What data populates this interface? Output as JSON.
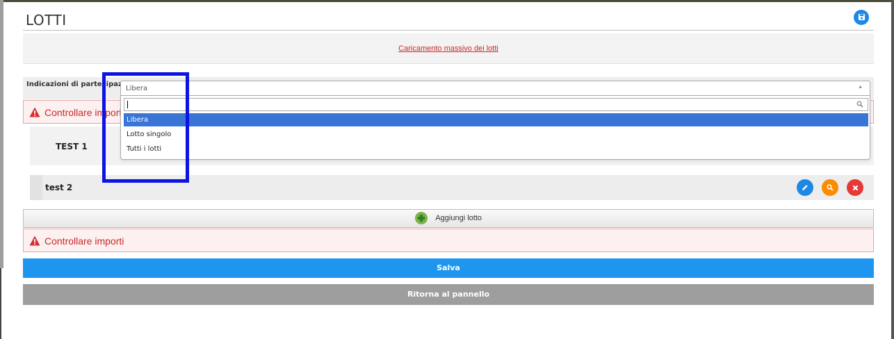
{
  "header": {
    "title": "LOTTI",
    "save_icon": "save-icon"
  },
  "mass_upload": {
    "link_label": "Caricamento massivo dei lotti"
  },
  "participation": {
    "label": "Indicazioni di partecipazione",
    "selected": "Libera",
    "search_value": "",
    "options": [
      "Libera",
      "Lotto singolo",
      "Tutti i lotti"
    ]
  },
  "warnings": {
    "top": "Controllare importi",
    "bottom": "Controllare importi"
  },
  "lots": [
    {
      "name": "TEST 1"
    },
    {
      "name": "test 2",
      "actions": [
        "edit-icon",
        "search-icon",
        "close-icon"
      ]
    }
  ],
  "add_lot": {
    "label": "Aggiungi lotto"
  },
  "buttons": {
    "save": "Salva",
    "back": "Ritorna al pannello"
  },
  "colors": {
    "primary": "#1e96f0",
    "warning": "#c62828",
    "edit": "#1e88e5",
    "view": "#fb8c00",
    "delete": "#e53935",
    "highlight": "#0b14e0",
    "selected_option": "#3875d7"
  }
}
